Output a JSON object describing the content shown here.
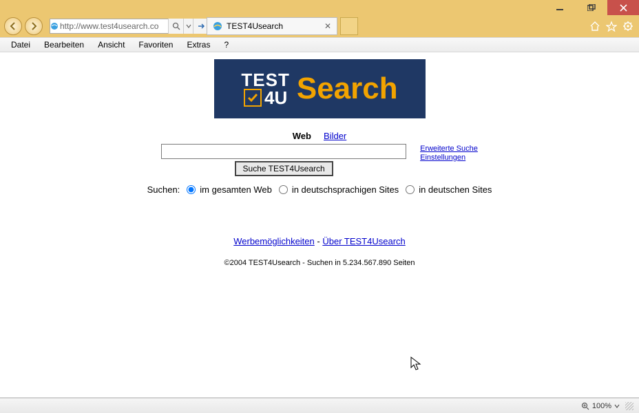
{
  "window": {
    "url": "http://www.test4usearch.co",
    "tab_title": "TEST4Usearch"
  },
  "menus": {
    "items": [
      "Datei",
      "Bearbeiten",
      "Ansicht",
      "Favoriten",
      "Extras",
      "?"
    ]
  },
  "logo": {
    "line1": "TEST",
    "line2": "4U",
    "word": "Search"
  },
  "page": {
    "tabs": {
      "web": "Web",
      "images": "Bilder"
    },
    "search_button": "Suche TEST4Usearch",
    "side": {
      "advanced": "Erweiterte Suche",
      "settings": "Einstellungen"
    },
    "scope": {
      "label": "Suchen:",
      "opt_all": "im gesamten Web",
      "opt_lang": "in deutschsprachigen Sites",
      "opt_country": "in deutschen Sites"
    },
    "footer": {
      "ads": "Werbemöglichkeiten",
      "sep": " - ",
      "about": "Über TEST4Usearch"
    },
    "copyright": "©2004 TEST4Usearch - Suchen in 5.234.567.890 Seiten"
  },
  "status": {
    "zoom": "100%"
  }
}
